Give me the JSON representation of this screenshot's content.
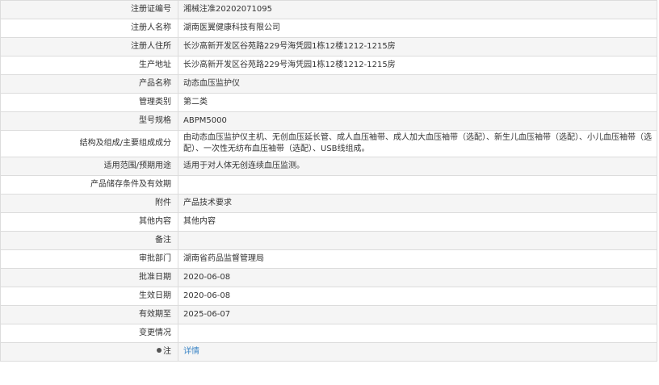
{
  "rows": [
    {
      "label": "注册证编号",
      "value": "湘械注准20202071095"
    },
    {
      "label": "注册人名称",
      "value": "湖南医翼健康科技有限公司"
    },
    {
      "label": "注册人住所",
      "value": "长沙高新开发区谷苑路229号海凭园1栋12楼1212-1215房"
    },
    {
      "label": "生产地址",
      "value": "长沙高新开发区谷苑路229号海凭园1栋12楼1212-1215房"
    },
    {
      "label": "产品名称",
      "value": "动态血压监护仪"
    },
    {
      "label": "管理类别",
      "value": "第二类"
    },
    {
      "label": "型号规格",
      "value": "ABPM5000"
    },
    {
      "label": "结构及组成/主要组成成分",
      "value": "由动态血压监护仪主机、无创血压延长管、成人血压袖带、成人加大血压袖带（选配）、新生儿血压袖带（选配）、小儿血压袖带（选配）、一次性无纺布血压袖带（选配）、USB线组成。"
    },
    {
      "label": "适用范围/预期用途",
      "value": "适用于对人体无创连续血压监测。"
    },
    {
      "label": "产品储存条件及有效期",
      "value": ""
    },
    {
      "label": "附件",
      "value": "产品技术要求"
    },
    {
      "label": "其他内容",
      "value": "其他内容"
    },
    {
      "label": "备注",
      "value": ""
    },
    {
      "label": "审批部门",
      "value": "湖南省药品监督管理局"
    },
    {
      "label": "批准日期",
      "value": "2020-06-08"
    },
    {
      "label": "生效日期",
      "value": "2020-06-08"
    },
    {
      "label": "有效期至",
      "value": "2025-06-07"
    },
    {
      "label": "变更情况",
      "value": ""
    }
  ],
  "note_row": {
    "label": "注",
    "link_text": "详情",
    "icon": "info-dot-icon"
  }
}
